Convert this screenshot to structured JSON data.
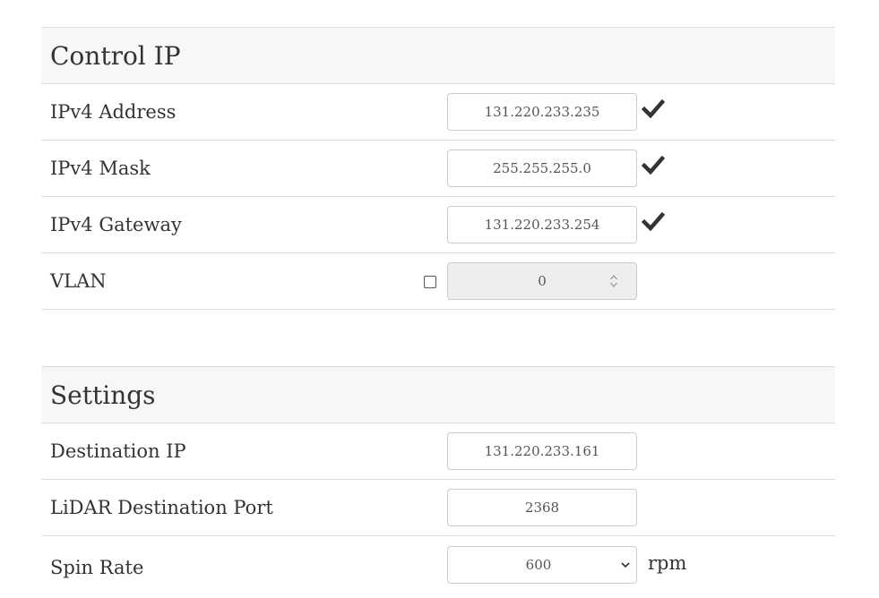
{
  "control_ip": {
    "title": "Control IP",
    "rows": [
      {
        "label": "IPv4 Address",
        "value": "131.220.233.235"
      },
      {
        "label": "IPv4 Mask",
        "value": "255.255.255.0"
      },
      {
        "label": "IPv4 Gateway",
        "value": "131.220.233.254"
      }
    ],
    "vlan": {
      "label": "VLAN",
      "value": "0",
      "enabled": false
    }
  },
  "settings": {
    "title": "Settings",
    "destination_ip": {
      "label": "Destination IP",
      "value": "131.220.233.161"
    },
    "lidar_port": {
      "label": "LiDAR Destination Port",
      "value": "2368"
    },
    "spin_rate": {
      "label": "Spin Rate",
      "value": "600",
      "unit": "rpm"
    }
  },
  "colors": {
    "valid_check": "#333333",
    "header_bg": "#f8f6f6",
    "border": "#dddddd"
  },
  "icons": {
    "valid": "checkmark-icon",
    "spinner": "number-spinner-icon",
    "select": "chevron-down-icon"
  }
}
